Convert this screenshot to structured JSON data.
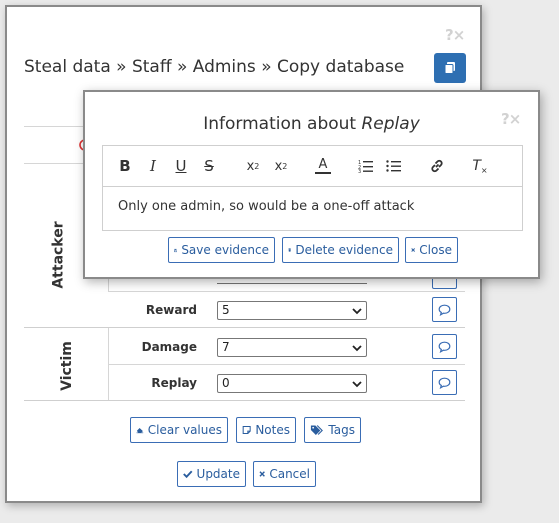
{
  "main": {
    "help_close": "?×",
    "title": "Steal data » Staff » Admins » Copy database",
    "groups": {
      "attacker": "Attacker",
      "victim": "Victim"
    },
    "rows": [
      {
        "label": "Reward",
        "value": "5"
      },
      {
        "label": "Damage",
        "value": "7"
      },
      {
        "label": "Replay",
        "value": "0"
      }
    ],
    "buttons": {
      "clear_values": "Clear values",
      "notes": "Notes",
      "tags": "Tags",
      "update": "Update",
      "cancel": "Cancel"
    }
  },
  "overlay": {
    "help_close": "?×",
    "title_prefix": "Information about",
    "title_item": "Replay",
    "editor_text": "Only one admin, so would be a one-off attack",
    "toolbar": [
      "bold",
      "italic",
      "underline",
      "strikethrough",
      "subscript",
      "superscript",
      "text-color",
      "ordered-list",
      "bullet-list",
      "link",
      "clear-format"
    ],
    "buttons": {
      "save": "Save evidence",
      "delete": "Delete evidence",
      "close": "Close"
    }
  },
  "colors": {
    "accent": "#2e6fb2",
    "link": "#2a5d9e"
  }
}
